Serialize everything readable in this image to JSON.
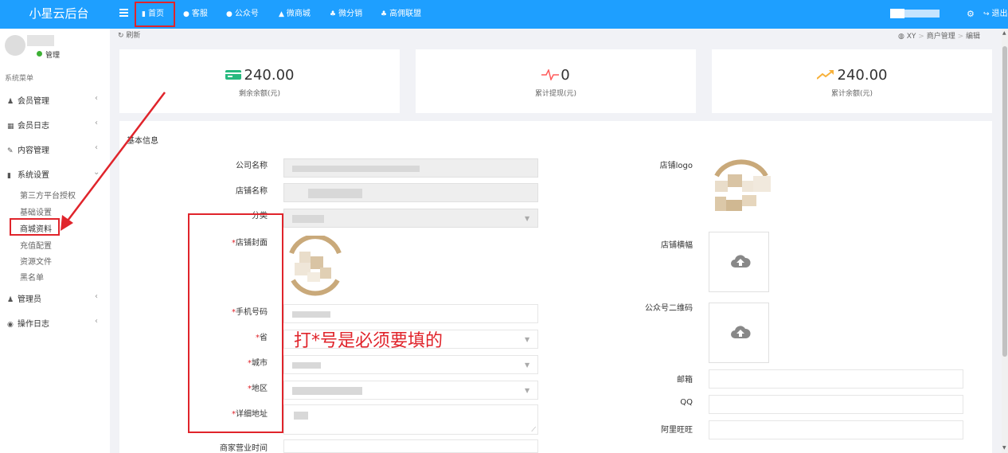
{
  "brand": "小星云后台",
  "nav": {
    "menu_icon": "menu-icon",
    "items": [
      {
        "label": "首页",
        "icon": "bookmark-icon"
      },
      {
        "label": "客服",
        "icon": "chat-icon"
      },
      {
        "label": "公众号",
        "icon": "chat-icon"
      },
      {
        "label": "微商城",
        "icon": "shop-icon"
      },
      {
        "label": "微分销",
        "icon": "sitemap-icon"
      },
      {
        "label": "高佣联盟",
        "icon": "sitemap-icon"
      }
    ],
    "logout": "退出"
  },
  "sidebar": {
    "role": "管理",
    "section_title": "系统菜单",
    "menus": [
      {
        "label": "会员管理",
        "icon": "user-icon"
      },
      {
        "label": "会员日志",
        "icon": "file-icon"
      },
      {
        "label": "内容管理",
        "icon": "edit-icon"
      },
      {
        "label": "系统设置",
        "icon": "settings-icon"
      }
    ],
    "submenu": [
      "第三方平台授权",
      "基础设置",
      "商城资料",
      "充值配置",
      "资源文件",
      "黑名单"
    ],
    "menus_after": [
      {
        "label": "管理员",
        "icon": "admin-icon"
      },
      {
        "label": "操作日志",
        "icon": "log-icon"
      }
    ]
  },
  "toolbar": {
    "refresh": "刷新",
    "breadcrumb": [
      "XY",
      "商户管理",
      "编辑"
    ]
  },
  "stats": [
    {
      "value": "240.00",
      "label": "剩余余额(元)",
      "icon": "card-icon",
      "color": "#27b97f"
    },
    {
      "value": "0",
      "label": "累计提现(元)",
      "icon": "pulse-icon",
      "color": "#ff5b5b"
    },
    {
      "value": "240.00",
      "label": "累计余额(元)",
      "icon": "trend-up-icon",
      "color": "#f7b13a"
    }
  ],
  "form": {
    "section_title": "基本信息",
    "left_fields": [
      {
        "label": "公司名称",
        "required": false
      },
      {
        "label": "店铺名称",
        "required": false
      },
      {
        "label": "分类",
        "required": false
      },
      {
        "label": "店铺封面",
        "required": true
      },
      {
        "label": "手机号码",
        "required": true
      },
      {
        "label": "省",
        "required": true
      },
      {
        "label": "城市",
        "required": true
      },
      {
        "label": "地区",
        "required": true
      },
      {
        "label": "详细地址",
        "required": true
      },
      {
        "label": "商家营业时间",
        "required": false
      }
    ],
    "right_fields": [
      "店铺logo",
      "店铺横幅",
      "公众号二维码",
      "邮箱",
      "QQ",
      "阿里旺旺"
    ],
    "required_mark": "*"
  },
  "annotation": "打*号是必须要填的",
  "colors": {
    "topbar": "#1e9fff",
    "highlight": "#e0242b",
    "online": "#3cb034"
  }
}
